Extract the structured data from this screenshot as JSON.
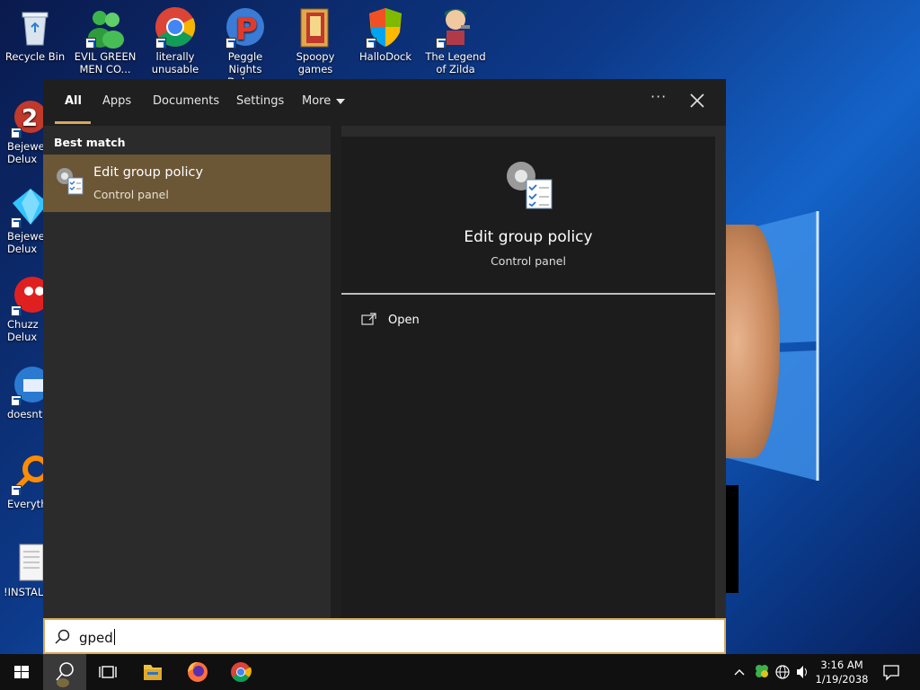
{
  "desktop": {
    "icons_top": [
      {
        "label": "Recycle Bin"
      },
      {
        "label": "EVIL GREEN MEN CO..."
      },
      {
        "label": "literally unusable"
      },
      {
        "label": "Peggle Nights Deluxe"
      },
      {
        "label": "Spoopy games"
      },
      {
        "label": "HalloDock"
      },
      {
        "label": "The Legend of Zilda"
      }
    ],
    "icons_left": [
      {
        "label": "Bejewel Delux"
      },
      {
        "label": "Bejewe Delux"
      },
      {
        "label": "Chuzz Delux"
      },
      {
        "label": "doesnt"
      },
      {
        "label": "Everyth"
      },
      {
        "label": "!INSTALL"
      }
    ]
  },
  "search_panel": {
    "tabs": {
      "all": "All",
      "apps": "Apps",
      "documents": "Documents",
      "settings": "Settings",
      "more": "More"
    },
    "more_options": "···",
    "best_match_heading": "Best match",
    "result": {
      "title": "Edit group policy",
      "subtitle": "Control panel"
    },
    "preview": {
      "title": "Edit group policy",
      "subtitle": "Control panel",
      "open_label": "Open"
    }
  },
  "search_box": {
    "value": "gped"
  },
  "taskbar": {
    "clock_time": "3:16 AM",
    "clock_date": "1/19/2038"
  },
  "colors": {
    "accent": "#d4a95a",
    "selected_result": "#6b5636",
    "panel_bg": "#2b2b2b"
  }
}
